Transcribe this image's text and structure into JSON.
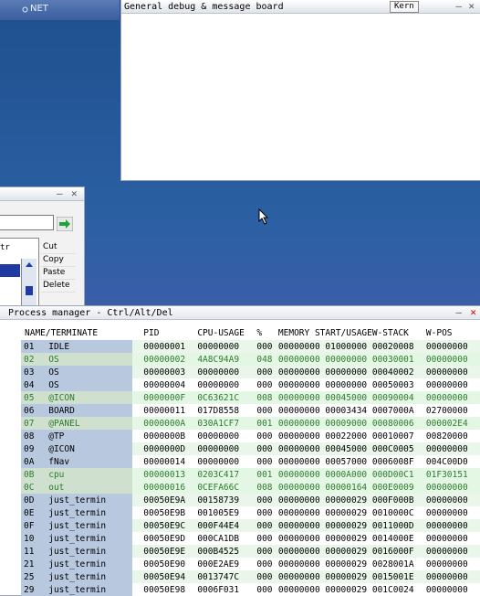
{
  "net_window": {
    "title": "NET"
  },
  "debug_window": {
    "title": "General debug & message board",
    "badge": "Kern",
    "min": "–",
    "close": "✕"
  },
  "editor_window": {
    "min": "–",
    "close": "✕",
    "header": "tr",
    "menu": [
      "Cut",
      "Copy",
      "Paste",
      "Delete"
    ]
  },
  "process_manager": {
    "title": "Process manager - Ctrl/Alt/Del",
    "min": "–",
    "close": "✕",
    "columns": [
      "NAME/TERMINATE",
      "PID",
      "CPU-USAGE",
      "%",
      "MEMORY START/USAGE",
      "",
      "W-STACK",
      "W-POS"
    ],
    "rows": [
      {
        "id": "01",
        "name": "IDLE",
        "pid": "00000001",
        "cpu": "00000000",
        "pct": "000",
        "mem": "00000000",
        "use": "01000000",
        "stack": "00020008",
        "pos": "00000000",
        "green": false
      },
      {
        "id": "02",
        "name": "OS",
        "pid": "00000002",
        "cpu": "4A8C94A9",
        "pct": "048",
        "mem": "00000000",
        "use": "00000000",
        "stack": "00030001",
        "pos": "00000000",
        "green": true
      },
      {
        "id": "03",
        "name": "OS",
        "pid": "00000003",
        "cpu": "00000000",
        "pct": "000",
        "mem": "00000000",
        "use": "00000000",
        "stack": "00040002",
        "pos": "00000000",
        "green": false
      },
      {
        "id": "04",
        "name": "OS",
        "pid": "00000004",
        "cpu": "00000000",
        "pct": "000",
        "mem": "00000000",
        "use": "00000000",
        "stack": "00050003",
        "pos": "00000000",
        "green": false
      },
      {
        "id": "05",
        "name": "@ICON",
        "pid": "0000000F",
        "cpu": "0C63621C",
        "pct": "008",
        "mem": "00000000",
        "use": "00045000",
        "stack": "00090004",
        "pos": "00000000",
        "green": true
      },
      {
        "id": "06",
        "name": "BOARD",
        "pid": "00000011",
        "cpu": "017D8558",
        "pct": "000",
        "mem": "00000000",
        "use": "00003434",
        "stack": "0007000A",
        "pos": "02700000",
        "green": false
      },
      {
        "id": "07",
        "name": "@PANEL",
        "pid": "0000000A",
        "cpu": "030A1CF7",
        "pct": "001",
        "mem": "00000000",
        "use": "00009000",
        "stack": "00080006",
        "pos": "000002E4",
        "green": true
      },
      {
        "id": "08",
        "name": "@TP",
        "pid": "0000000B",
        "cpu": "00000000",
        "pct": "000",
        "mem": "00000000",
        "use": "00022000",
        "stack": "00010007",
        "pos": "00820000",
        "green": false
      },
      {
        "id": "09",
        "name": "@ICON",
        "pid": "0000000D",
        "cpu": "00000000",
        "pct": "000",
        "mem": "00000000",
        "use": "00045000",
        "stack": "000C0005",
        "pos": "00000000",
        "green": false
      },
      {
        "id": "0A",
        "name": "fNav",
        "pid": "00000014",
        "cpu": "00000000",
        "pct": "000",
        "mem": "00000000",
        "use": "00057000",
        "stack": "0006008F",
        "pos": "004C00D0",
        "green": false
      },
      {
        "id": "0B",
        "name": "cpu",
        "pid": "00000013",
        "cpu": "0203C417",
        "pct": "001",
        "mem": "00000000",
        "use": "0000A000",
        "stack": "000D00C1",
        "pos": "01F30151",
        "green": true
      },
      {
        "id": "0C",
        "name": "out",
        "pid": "00000016",
        "cpu": "0CEFA66C",
        "pct": "008",
        "mem": "00000000",
        "use": "00000164",
        "stack": "000E0009",
        "pos": "00000000",
        "green": true
      },
      {
        "id": "0D",
        "name": "just_termin",
        "pid": "00050E9A",
        "cpu": "00158739",
        "pct": "000",
        "mem": "00000000",
        "use": "00000029",
        "stack": "000F000B",
        "pos": "00000000",
        "green": false
      },
      {
        "id": "0E",
        "name": "just_termin",
        "pid": "00050E9B",
        "cpu": "001005E9",
        "pct": "000",
        "mem": "00000000",
        "use": "00000029",
        "stack": "0010000C",
        "pos": "00000000",
        "green": false
      },
      {
        "id": "0F",
        "name": "just_termin",
        "pid": "00050E9C",
        "cpu": "000F44E4",
        "pct": "000",
        "mem": "00000000",
        "use": "00000029",
        "stack": "0011000D",
        "pos": "00000000",
        "green": false
      },
      {
        "id": "10",
        "name": "just_termin",
        "pid": "00050E9D",
        "cpu": "000CA1DB",
        "pct": "000",
        "mem": "00000000",
        "use": "00000029",
        "stack": "0014000E",
        "pos": "00000000",
        "green": false
      },
      {
        "id": "11",
        "name": "just_termin",
        "pid": "00050E9E",
        "cpu": "000B4525",
        "pct": "000",
        "mem": "00000000",
        "use": "00000029",
        "stack": "0016000F",
        "pos": "00000000",
        "green": false
      },
      {
        "id": "21",
        "name": "just_termin",
        "pid": "00050E90",
        "cpu": "000E2AE9",
        "pct": "000",
        "mem": "00000000",
        "use": "00000029",
        "stack": "0028001A",
        "pos": "00000000",
        "green": false
      },
      {
        "id": "25",
        "name": "just_termin",
        "pid": "00050E94",
        "cpu": "0013747C",
        "pct": "000",
        "mem": "00000000",
        "use": "00000029",
        "stack": "0015001E",
        "pos": "00000000",
        "green": false
      },
      {
        "id": "29",
        "name": "just_termin",
        "pid": "00050E98",
        "cpu": "0006F031",
        "pct": "000",
        "mem": "00000000",
        "use": "00000029",
        "stack": "001C0024",
        "pos": "00000000",
        "green": false
      }
    ]
  }
}
